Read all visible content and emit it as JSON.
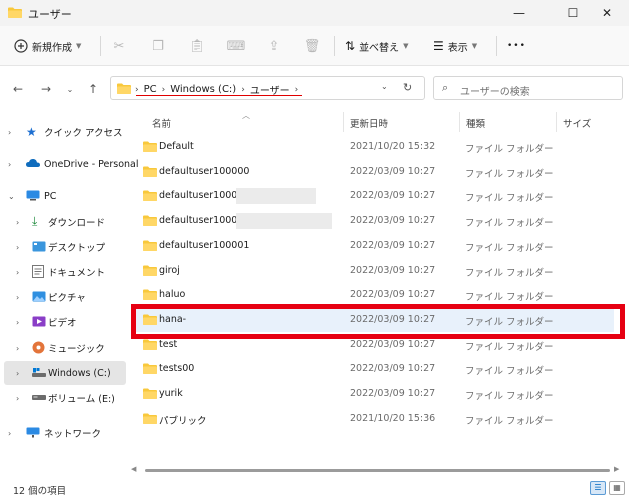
{
  "window": {
    "title": "ユーザー",
    "minimize_glyph": "—",
    "maximize_glyph": "☐",
    "close_glyph": "✕"
  },
  "toolbar": {
    "new_label": "新規作成",
    "sort_label": "並べ替え",
    "view_label": "表示",
    "more_glyph": "•••"
  },
  "address": {
    "crumbs": [
      "PC",
      "Windows (C:)",
      "ユーザー"
    ],
    "search_placeholder": "ユーザーの検索"
  },
  "sidebar": {
    "items": [
      {
        "label": "クイック アクセス",
        "icon": "star-icon"
      },
      {
        "label": "OneDrive - Personal",
        "icon": "cloud-icon"
      },
      {
        "label": "PC",
        "icon": "pc-icon"
      },
      {
        "label": "ダウンロード",
        "icon": "download-icon"
      },
      {
        "label": "デスクトップ",
        "icon": "desktop-icon"
      },
      {
        "label": "ドキュメント",
        "icon": "document-icon"
      },
      {
        "label": "ピクチャ",
        "icon": "picture-icon"
      },
      {
        "label": "ビデオ",
        "icon": "video-icon"
      },
      {
        "label": "ミュージック",
        "icon": "music-icon"
      },
      {
        "label": "Windows (C:)",
        "icon": "drive-icon"
      },
      {
        "label": "ボリューム (E:)",
        "icon": "volume-icon"
      },
      {
        "label": "ネットワーク",
        "icon": "network-icon"
      }
    ]
  },
  "columns": {
    "name": "名前",
    "date": "更新日時",
    "type": "種類",
    "size": "サイズ"
  },
  "files": [
    {
      "name": "Default",
      "date": "2021/10/20 15:32",
      "type": "ファイル フォルダー"
    },
    {
      "name": "defaultuser100000",
      "date": "2022/03/09 10:27",
      "type": "ファイル フォルダー"
    },
    {
      "name": "defaultuser100000",
      "date": "2022/03/09 10:27",
      "type": "ファイル フォルダー"
    },
    {
      "name": "defaultuser100000",
      "date": "2022/03/09 10:27",
      "type": "ファイル フォルダー"
    },
    {
      "name": "defaultuser100001",
      "date": "2022/03/09 10:27",
      "type": "ファイル フォルダー"
    },
    {
      "name": "giroj",
      "date": "2022/03/09 10:27",
      "type": "ファイル フォルダー"
    },
    {
      "name": "haluo",
      "date": "2022/03/09 10:27",
      "type": "ファイル フォルダー"
    },
    {
      "name": "hana-",
      "date": "2022/03/09 10:27",
      "type": "ファイル フォルダー"
    },
    {
      "name": "test",
      "date": "2022/03/09 10:27",
      "type": "ファイル フォルダー"
    },
    {
      "name": "tests00",
      "date": "2022/03/09 10:27",
      "type": "ファイル フォルダー"
    },
    {
      "name": "yurik",
      "date": "2022/03/09 10:27",
      "type": "ファイル フォルダー"
    },
    {
      "name": "パブリック",
      "date": "2021/10/20 15:36",
      "type": "ファイル フォルダー"
    }
  ],
  "status": {
    "item_count": "12 個の項目"
  },
  "colors": {
    "highlight": "#e60012",
    "folder": "#f8c83c",
    "selected_row": "#e8f1fb",
    "accent": "#0067c0"
  }
}
